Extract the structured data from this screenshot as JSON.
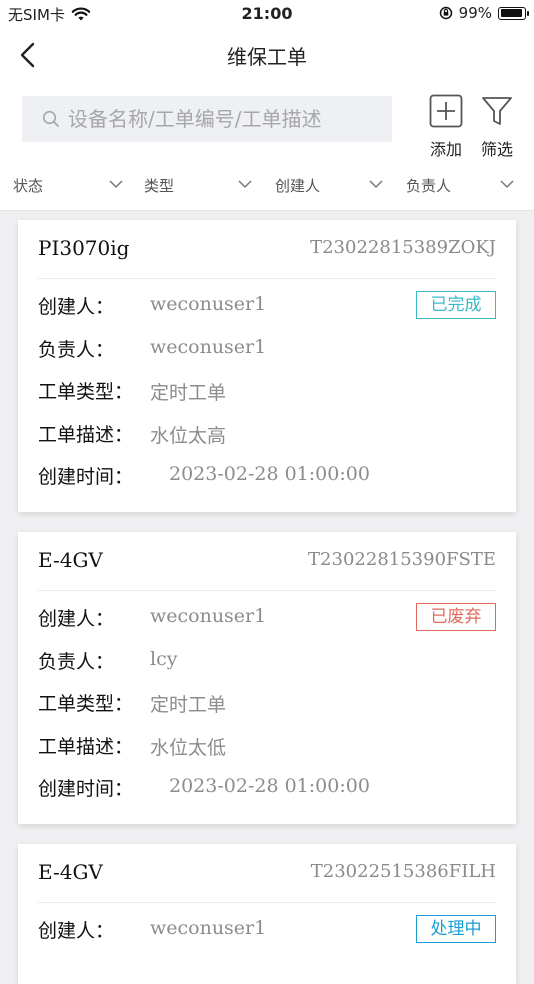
{
  "status_bar": {
    "carrier": "无SIM卡",
    "time": "21:00",
    "battery": "99%",
    "battery_level": 0.99
  },
  "nav": {
    "title": "维保工单"
  },
  "search": {
    "placeholder": "设备名称/工单编号/工单描述"
  },
  "tools": {
    "add_label": "添加",
    "filter_label": "筛选"
  },
  "filters": [
    {
      "label": "状态"
    },
    {
      "label": "类型"
    },
    {
      "label": "创建人"
    },
    {
      "label": "负责人"
    }
  ],
  "labels": {
    "creator": "创建人：",
    "owner": "负责人：",
    "type": "工单类型：",
    "desc": "工单描述：",
    "created_time": "创建时间："
  },
  "colors": {
    "done": "#3bb9c8",
    "abandoned": "#e06a5d",
    "processing": "#1a9ed6"
  },
  "orders": [
    {
      "device": "PI3070ig",
      "code": "T23022815389ZOKJ",
      "status": "已完成",
      "creator": "weconuser1",
      "owner": "weconuser1",
      "type": "定时工单",
      "desc": "水位太高",
      "created": "2023-02-28 01:00:00"
    },
    {
      "device": "E-4GV",
      "code": "T23022815390FSTE",
      "status": "已废弃",
      "creator": "weconuser1",
      "owner": "lcy",
      "type": "定时工单",
      "desc": "水位太低",
      "created": "2023-02-28 01:00:00"
    },
    {
      "device": "E-4GV",
      "code": "T23022515386FILH",
      "status": "处理中",
      "creator": "weconuser1"
    }
  ]
}
